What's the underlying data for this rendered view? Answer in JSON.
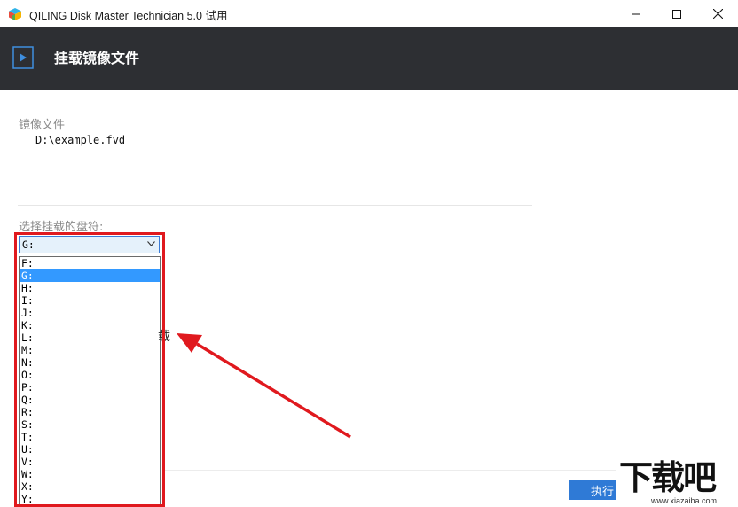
{
  "window": {
    "title": "QILING Disk Master Technician 5.0 试用",
    "controls": [
      "minimize-icon",
      "maximize-icon",
      "close-icon"
    ]
  },
  "header": {
    "title": "挂载镜像文件",
    "icon": "play-icon"
  },
  "image_file": {
    "label": "镜像文件",
    "path": "D:\\example.fvd"
  },
  "drive_select": {
    "label": "选择挂载的盘符:",
    "selected": "G:",
    "options": [
      "F:",
      "G:",
      "H:",
      "I:",
      "J:",
      "K:",
      "L:",
      "M:",
      "N:",
      "O:",
      "P:",
      "Q:",
      "R:",
      "S:",
      "T:",
      "U:",
      "V:",
      "W:",
      "X:",
      "Y:"
    ],
    "selected_index": 1
  },
  "partially_hidden_text": "载",
  "footer": {
    "execute_label": "执行"
  },
  "watermark": {
    "text": "下载吧",
    "url": "www.xiazaiba.com"
  },
  "colors": {
    "header_bg": "#2d2f33",
    "accent": "#2f7ad6",
    "highlight": "#3399ff",
    "annotation": "#e0191e"
  }
}
